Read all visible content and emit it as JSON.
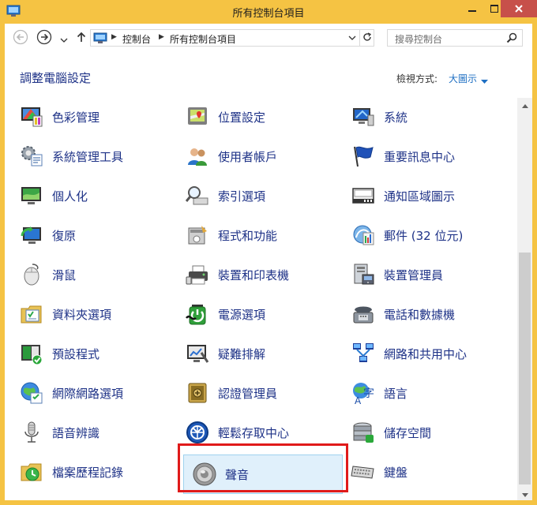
{
  "window": {
    "title": "所有控制台項目",
    "controls": {
      "minimize_icon": "minimize-icon",
      "maximize_icon": "maximize-icon",
      "close_icon": "close-icon"
    },
    "accent_color": "#f5c343",
    "close_color": "#c7504a"
  },
  "navbar": {
    "back_icon": "back-arrow-icon",
    "forward_icon": "forward-arrow-icon",
    "up_icon": "up-arrow-icon",
    "breadcrumb": [
      "控制台",
      "所有控制台項目"
    ],
    "search_placeholder": "搜尋控制台"
  },
  "header": {
    "title": "調整電腦設定",
    "view_label": "檢視方式:",
    "view_value": "大圖示",
    "view_value_color": "#1e6fc3"
  },
  "items": [
    {
      "label": "色彩管理",
      "icon": "color-management-icon"
    },
    {
      "label": "位置設定",
      "icon": "location-settings-icon"
    },
    {
      "label": "系統",
      "icon": "system-icon"
    },
    {
      "label": "系統管理工具",
      "icon": "administrative-tools-icon"
    },
    {
      "label": "使用者帳戶",
      "icon": "user-accounts-icon"
    },
    {
      "label": "重要訊息中心",
      "icon": "action-center-flag-icon"
    },
    {
      "label": "個人化",
      "icon": "personalization-icon"
    },
    {
      "label": "索引選項",
      "icon": "indexing-options-icon"
    },
    {
      "label": "通知區域圖示",
      "icon": "notification-area-icons-icon"
    },
    {
      "label": "復原",
      "icon": "recovery-icon"
    },
    {
      "label": "程式和功能",
      "icon": "programs-features-icon"
    },
    {
      "label": "郵件 (32 位元)",
      "icon": "mail-icon"
    },
    {
      "label": "滑鼠",
      "icon": "mouse-icon"
    },
    {
      "label": "裝置和印表機",
      "icon": "devices-printers-icon"
    },
    {
      "label": "裝置管理員",
      "icon": "device-manager-icon"
    },
    {
      "label": "資料夾選項",
      "icon": "folder-options-icon"
    },
    {
      "label": "電源選項",
      "icon": "power-options-icon"
    },
    {
      "label": "電話和數據機",
      "icon": "phone-modem-icon"
    },
    {
      "label": "預設程式",
      "icon": "default-programs-icon"
    },
    {
      "label": "疑難排解",
      "icon": "troubleshooting-icon"
    },
    {
      "label": "網路和共用中心",
      "icon": "network-sharing-icon"
    },
    {
      "label": "網際網路選項",
      "icon": "internet-options-icon"
    },
    {
      "label": "認證管理員",
      "icon": "credential-manager-icon"
    },
    {
      "label": "語言",
      "icon": "language-icon"
    },
    {
      "label": "語音辨識",
      "icon": "speech-recognition-icon"
    },
    {
      "label": "輕鬆存取中心",
      "icon": "ease-of-access-icon"
    },
    {
      "label": "儲存空間",
      "icon": "storage-spaces-icon"
    },
    {
      "label": "檔案歷程記錄",
      "icon": "file-history-icon"
    },
    {
      "label": "聲音",
      "icon": "sound-speaker-icon",
      "selected": true
    },
    {
      "label": "鍵盤",
      "icon": "keyboard-icon"
    }
  ]
}
